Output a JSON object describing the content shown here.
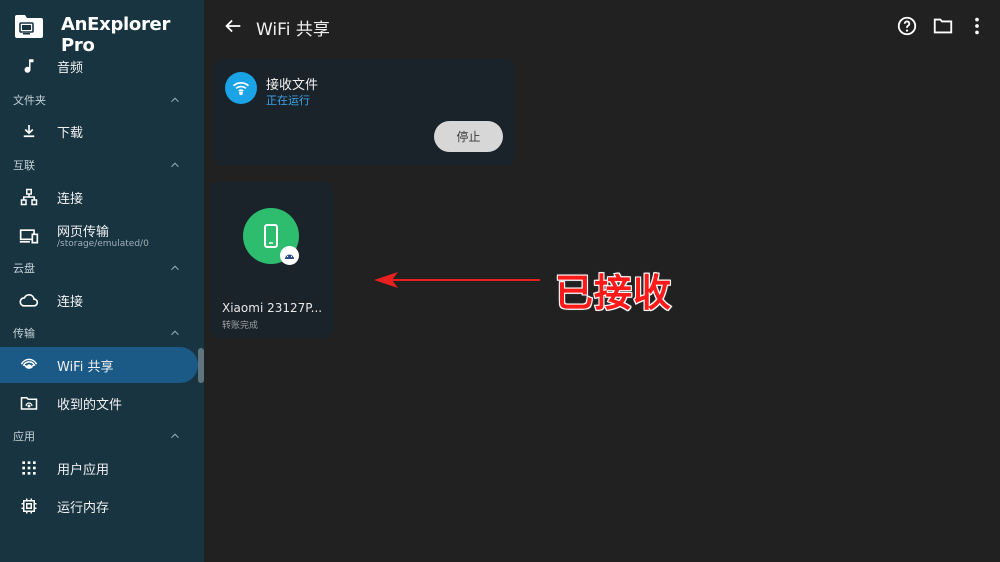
{
  "app": {
    "title": "AnExplorer Pro"
  },
  "sidebar": {
    "items": [
      {
        "label": "音频",
        "icon": "music-note-icon"
      },
      {
        "label": "下载",
        "icon": "download-icon"
      },
      {
        "label": "连接",
        "icon": "network-icon"
      },
      {
        "label": "网页传输",
        "sub": "/storage/emulated/0",
        "icon": "devices-icon"
      },
      {
        "label": "连接",
        "icon": "cloud-icon"
      },
      {
        "label": "WiFi 共享",
        "icon": "wifi-share-icon",
        "active": true
      },
      {
        "label": "收到的文件",
        "icon": "received-folder-icon"
      },
      {
        "label": "用户应用",
        "icon": "apps-grid-icon"
      },
      {
        "label": "运行内存",
        "icon": "chip-icon"
      }
    ],
    "sections": [
      {
        "title": "文件夹"
      },
      {
        "title": "互联"
      },
      {
        "title": "云盘"
      },
      {
        "title": "传输"
      },
      {
        "title": "应用"
      }
    ]
  },
  "header": {
    "title": "WiFi 共享",
    "icons": [
      "help-icon",
      "folder-icon",
      "more-vert-icon"
    ]
  },
  "receive_card": {
    "title": "接收文件",
    "status": "正在运行",
    "stop_label": "停止"
  },
  "device": {
    "name": "Xiaomi 23127P...",
    "status": "转账完成"
  },
  "annotation": {
    "text": "已接收"
  },
  "colors": {
    "sidebar_bg": "#183441",
    "content_bg": "#212121",
    "card_bg": "#1a2329",
    "active_item": "#1b5a86",
    "wifi_blue": "#1aa3e6",
    "status_blue": "#39a6ee",
    "device_green": "#2ebd6e",
    "annotation_red": "#ff1a1a"
  }
}
